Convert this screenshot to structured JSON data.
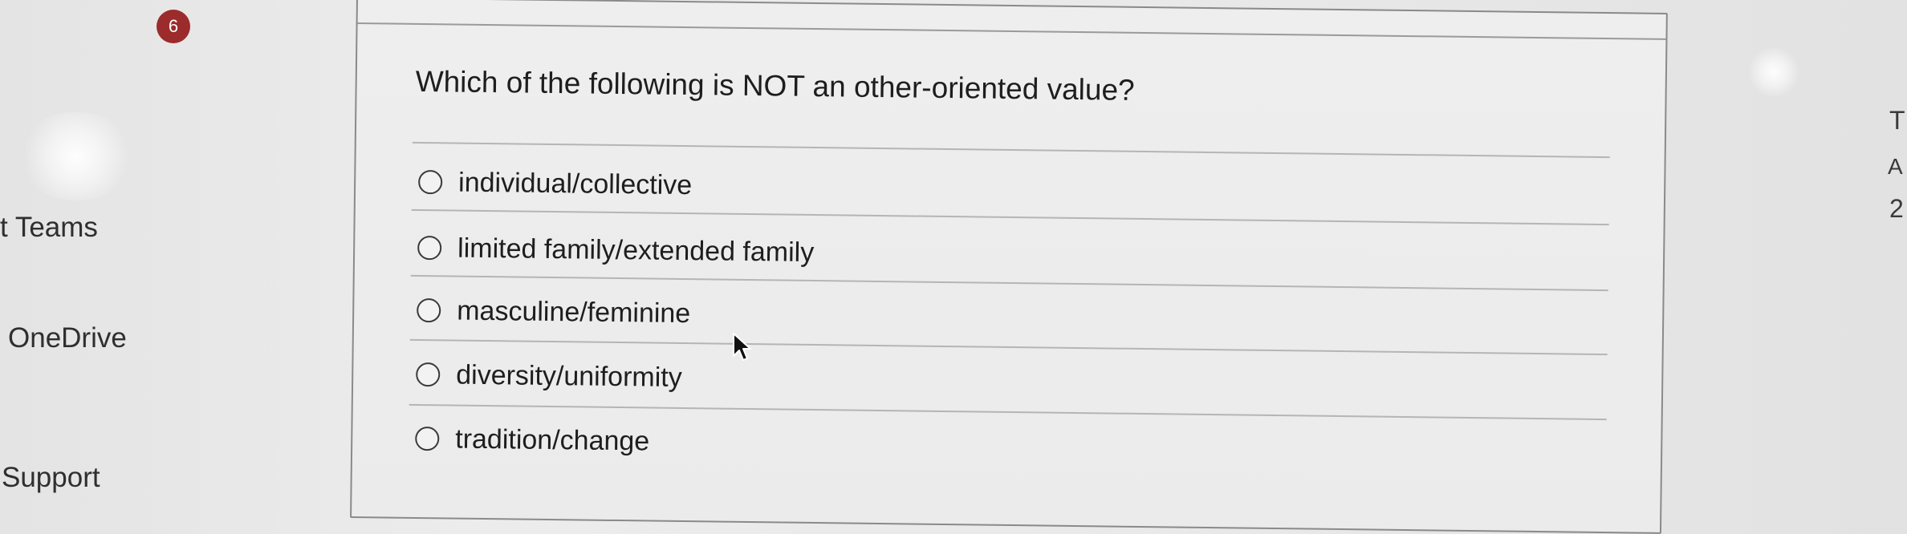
{
  "nav": {
    "items": [
      {
        "label": "t Teams"
      },
      {
        "label": "OneDrive"
      },
      {
        "label": "Support"
      }
    ]
  },
  "question": {
    "number": "6",
    "text": "Which of the following is NOT an other-oriented value?",
    "options": [
      {
        "label": "individual/collective",
        "selected": false
      },
      {
        "label": "limited family/extended family",
        "selected": false
      },
      {
        "label": "masculine/feminine",
        "selected": false
      },
      {
        "label": "diversity/uniformity",
        "selected": false
      },
      {
        "label": "tradition/change",
        "selected": false
      }
    ]
  },
  "right_panel": {
    "letters": [
      "T",
      "A",
      "2"
    ]
  },
  "colors": {
    "badge": "#9c2b2b",
    "background": "#e9e9e9",
    "card": "#ececec"
  },
  "icons": {
    "cursor": "mouse-pointer-icon",
    "radio": "radio-button-icon"
  }
}
